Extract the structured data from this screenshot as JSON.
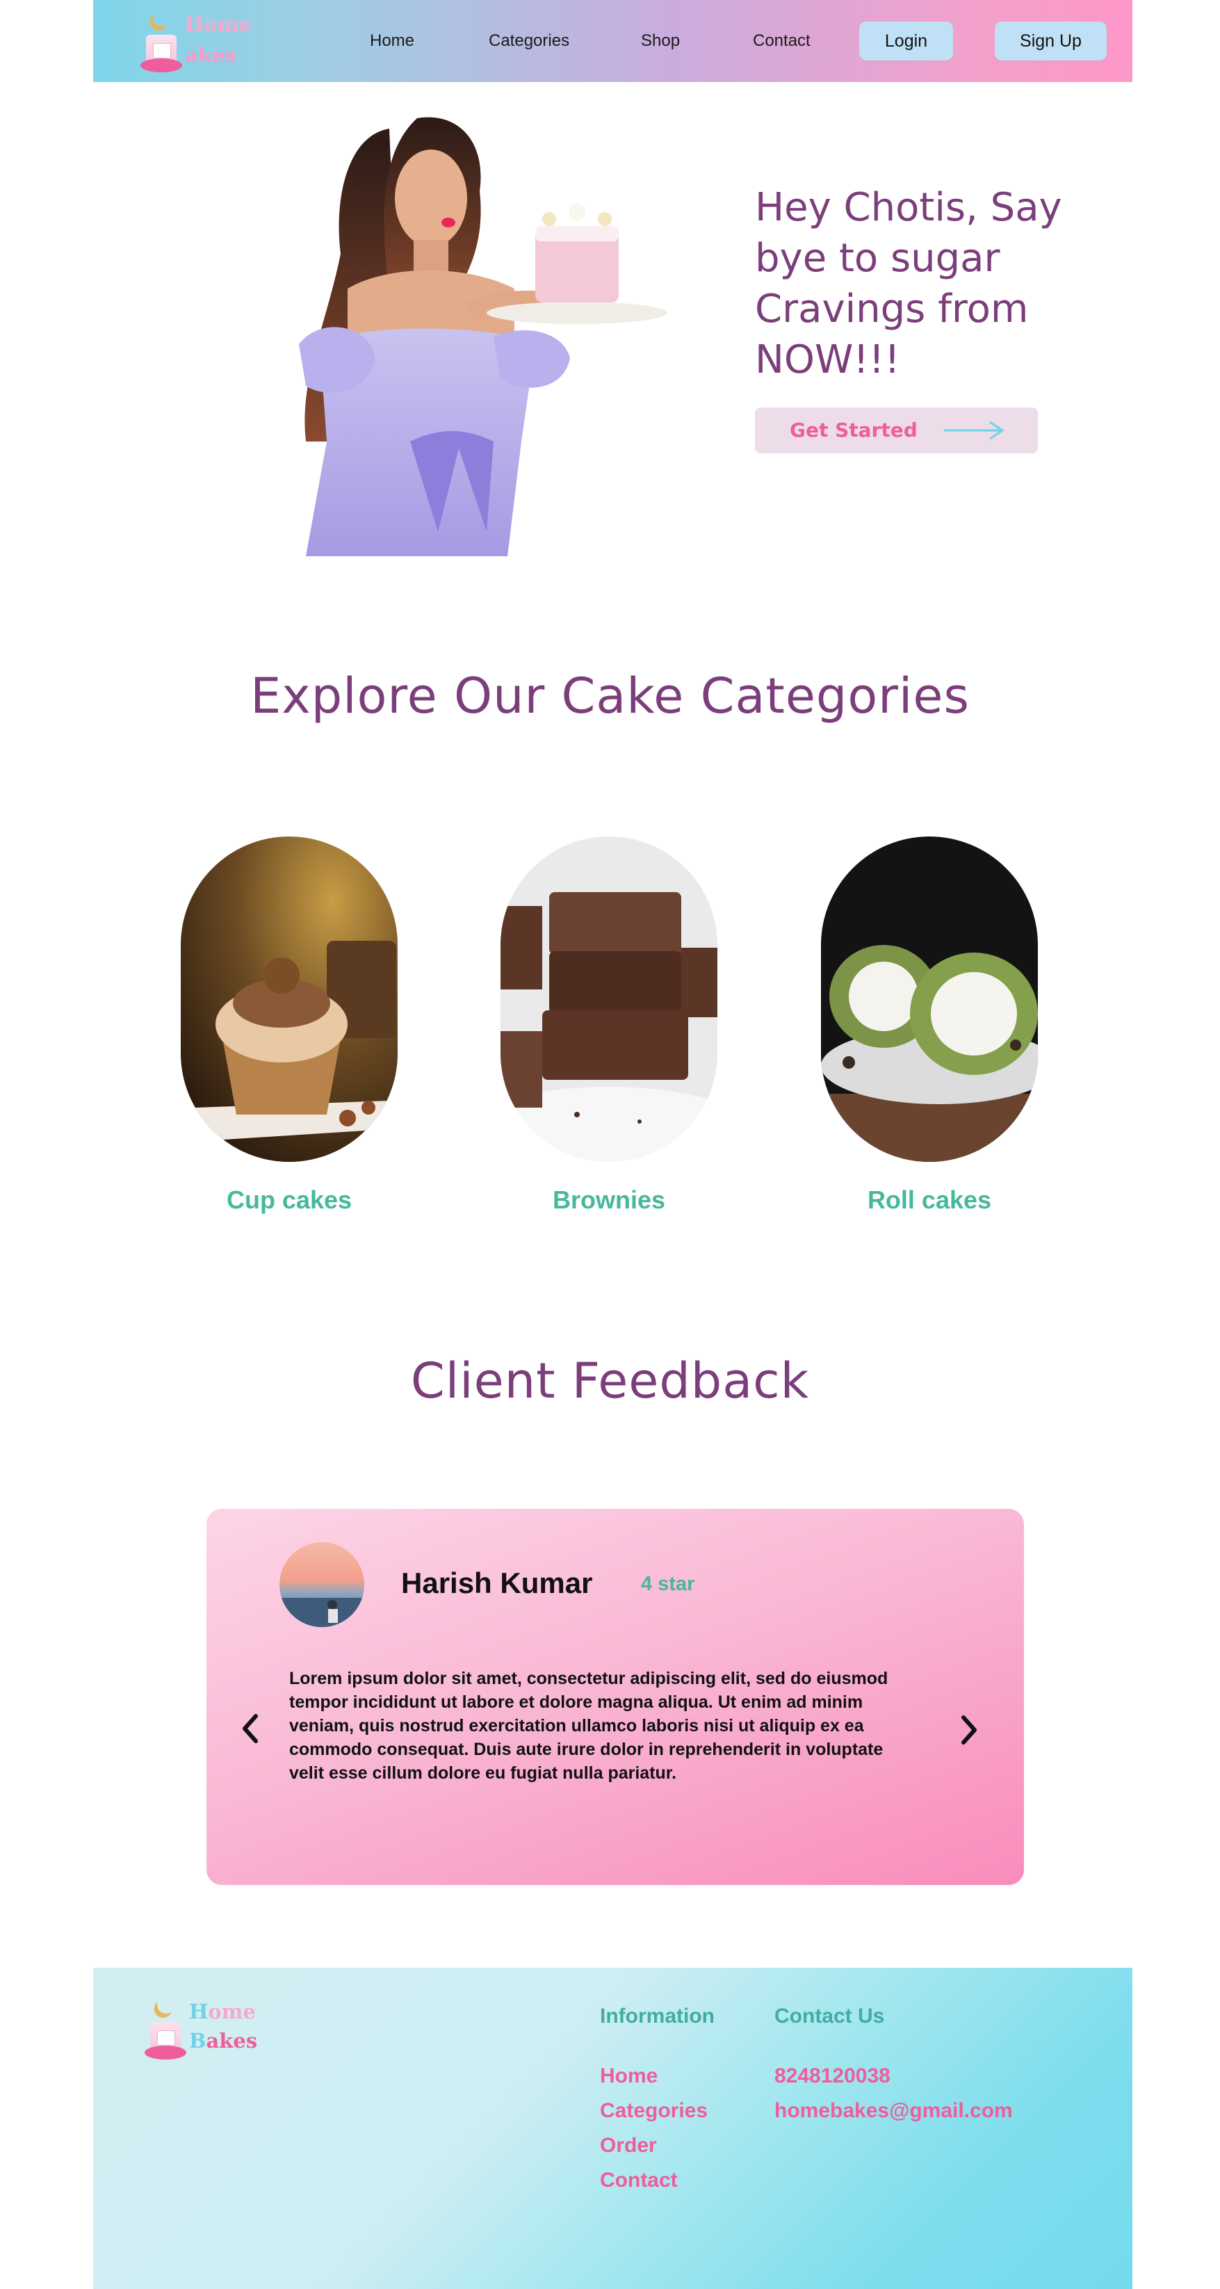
{
  "brand": {
    "logo_letter_1": "H",
    "logo_word_1": "ome",
    "logo_letter_2": "B",
    "logo_word_2": "akes"
  },
  "nav": {
    "links": [
      "Home",
      "Categories",
      "Shop",
      "Contact"
    ],
    "login_label": "Login",
    "signup_label": "Sign Up"
  },
  "hero": {
    "title": "Hey Chotis, Say bye to sugar Cravings from NOW!!!",
    "cta_label": "Get Started",
    "image": "woman-holding-cake-photo"
  },
  "categories": {
    "title": "Explore Our Cake Categories",
    "items": [
      {
        "label": "Cup cakes",
        "image": "cupcake-photo"
      },
      {
        "label": "Brownies",
        "image": "brownies-photo"
      },
      {
        "label": "Roll cakes",
        "image": "roll-cake-photo"
      }
    ]
  },
  "feedback": {
    "title": "Client Feedback",
    "name": "Harish Kumar",
    "rating": "4 star",
    "text": "Lorem ipsum dolor sit amet, consectetur adipiscing elit, sed do eiusmod tempor incididunt ut labore et dolore magna aliqua. Ut enim ad minim veniam, quis nostrud exercitation ullamco laboris nisi ut aliquip ex ea commodo consequat. Duis aute irure dolor in reprehenderit in voluptate velit esse cillum dolore eu fugiat nulla pariatur.",
    "prev_icon": "chevron-left-icon",
    "next_icon": "chevron-right-icon"
  },
  "footer": {
    "info_title": "Information",
    "info_links": [
      "Home",
      "Categories",
      "Order",
      "Contact"
    ],
    "contact_title": "Contact Us",
    "phone": "8248120038",
    "email": "homebakes@gmail.com"
  },
  "colors": {
    "plum": "#7b3e7b",
    "teal": "#46b89b",
    "pink": "#ef5d9c",
    "button_blue": "#c0e1f5"
  }
}
